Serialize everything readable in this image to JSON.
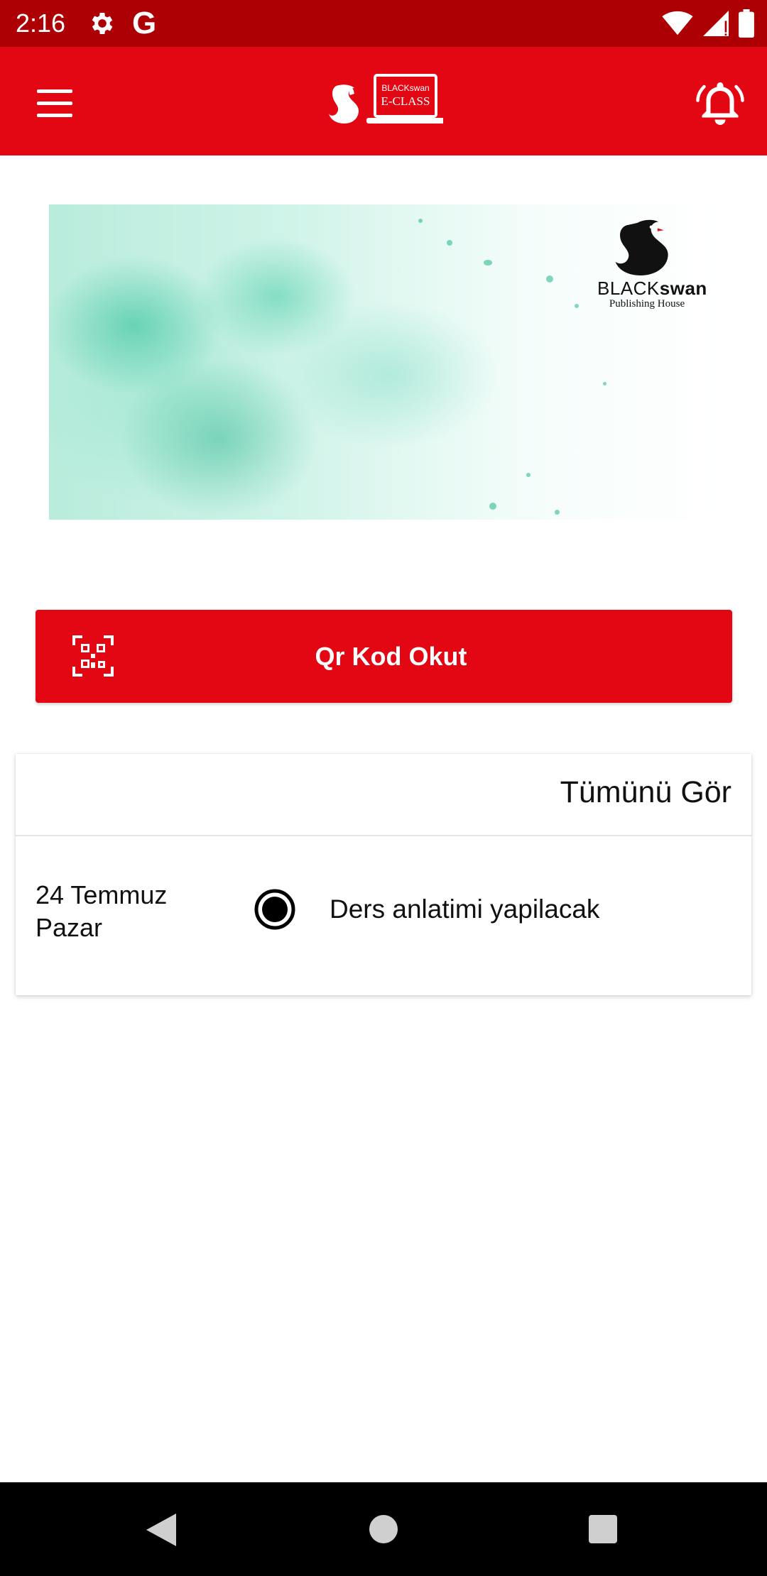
{
  "status_bar": {
    "time": "2:16",
    "icons": [
      "gear-icon",
      "google-icon",
      "wifi-icon",
      "signal-icon",
      "battery-icon"
    ],
    "google_glyph": "G"
  },
  "app_bar": {
    "color": "#e30613",
    "logo_text_top": "BLACKswan",
    "logo_text_bottom": "E-CLASS",
    "menu_icon": "hamburger-menu-icon",
    "notification_icon": "bell-icon"
  },
  "banner": {
    "publisher_brand_light": "BLACK",
    "publisher_brand_bold": "swan",
    "publisher_sub": "Publishing House"
  },
  "qr_button": {
    "label": "Qr Kod Okut",
    "icon": "qr-code-icon"
  },
  "schedule_card": {
    "see_all_label": "Tümünü Gör",
    "events": [
      {
        "date_line1": "24 Temmuz",
        "date_line2": "Pazar",
        "description": "Ders anlatimi yapilacak"
      }
    ]
  },
  "nav_bar": {
    "icons": [
      "back-icon",
      "home-icon",
      "recents-icon"
    ]
  }
}
